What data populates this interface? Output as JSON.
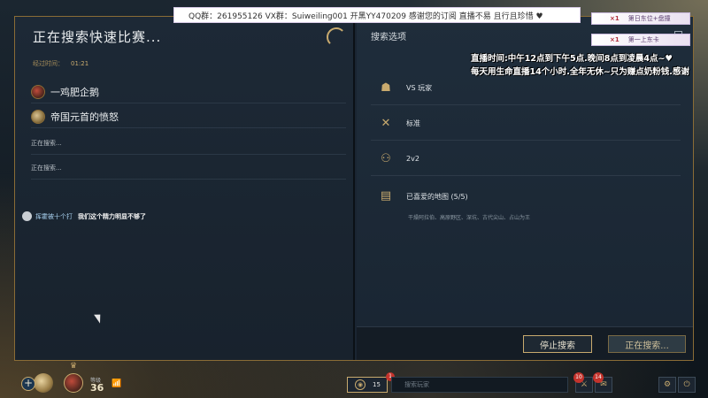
{
  "search_panel": {
    "title": "正在搜索快速比赛...",
    "elapsed_label": "经过时间：",
    "elapsed_value": "01:21",
    "players": [
      {
        "name": "一鸡肥企鹅"
      },
      {
        "name": "帝国元首的愤怒"
      }
    ],
    "searching_rows": [
      "正在搜索...",
      "正在搜索..."
    ]
  },
  "chat": {
    "user": "挥霍被十个打",
    "message": "我们这个精力明显不够了"
  },
  "options": {
    "title": "搜索选项",
    "collapse_label": "–",
    "rows": [
      {
        "icon": "vs-players-icon",
        "label": "VS 玩家"
      },
      {
        "icon": "standard-icon",
        "label": "标准"
      },
      {
        "icon": "team-size-icon",
        "label": "2v2"
      },
      {
        "icon": "map-icon",
        "label": "已喜爱的地图 (5/5)"
      }
    ],
    "maps_sub": "干燥阿拉伯、高原野区、深坑、古代尖山、占山为王"
  },
  "buttons": {
    "stop": "停止搜索",
    "searching": "正在搜索..."
  },
  "stream_overlay": {
    "marquee": "QQ群：261955126  VX群：Suiweiling001  开黑YY470209  感谢您的订阅 直播不易  且行且珍惜  ♥",
    "rank1": {
      "score": "×1",
      "label": "第日东位+盘撞"
    },
    "rank2": {
      "score": "×1",
      "label": "第一上东卡"
    },
    "line1": "直播时间:中午12点到下午5点.晚间8点到凌晨4点~♥",
    "line2": "每天用生命直播14个小时.全年无休~只为赚点奶粉钱.感谢"
  },
  "hud": {
    "plus": "+",
    "level_label": "等级",
    "level": "36",
    "friends_count": "15",
    "friends_badge": "1",
    "search_placeholder": "搜索玩家",
    "badge_left": "10",
    "badge_right": "14"
  },
  "colors": {
    "accent_gold": "#c8aa6e",
    "panel_bg": "#1d2936",
    "alert_red": "#c4332c"
  }
}
